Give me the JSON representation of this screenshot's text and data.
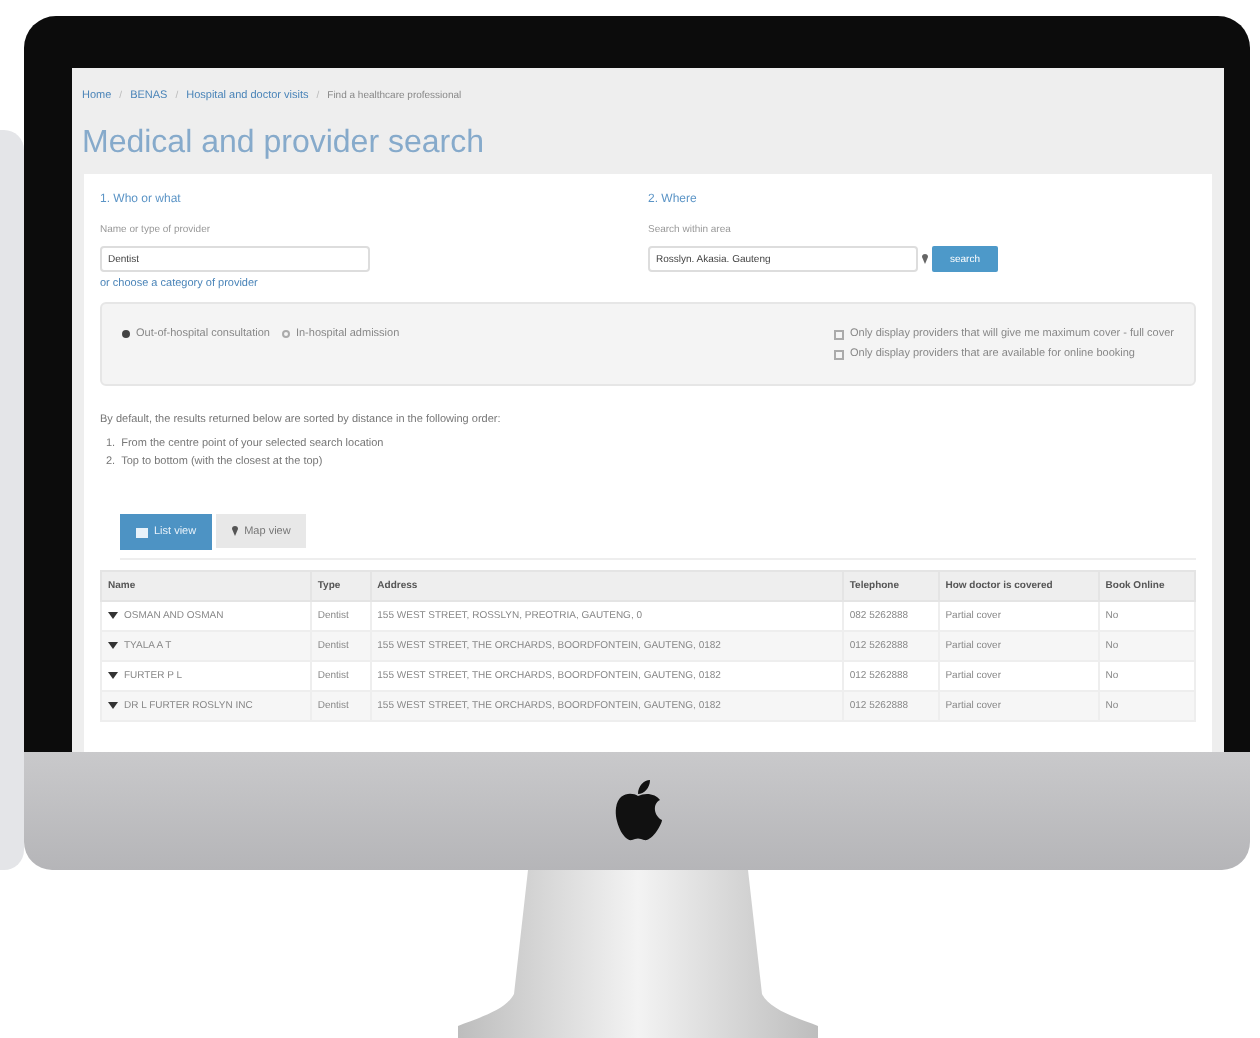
{
  "breadcrumb": {
    "separator": "/",
    "items": [
      {
        "label": "Home",
        "kind": "link"
      },
      {
        "label": "BENAS",
        "kind": "link"
      },
      {
        "label": "Hospital and doctor visits",
        "kind": "link"
      },
      {
        "label": "Find a healthcare professional",
        "kind": "current"
      }
    ]
  },
  "title": "Medical and provider search",
  "who": {
    "heading": "1. Who or what",
    "label": "Name or type of provider",
    "value": "Dentist",
    "link": "or choose a category of provider"
  },
  "where": {
    "heading": "2. Where",
    "label": "Search within area",
    "value": "Rosslyn. Akasia. Gauteng",
    "button": "search"
  },
  "radios": [
    {
      "label": "Out-of-hospital consultation",
      "selected": true
    },
    {
      "label": "In-hospital admission",
      "selected": false
    }
  ],
  "checkboxes": [
    {
      "label": "Only display providers that will give me maximum cover - full cover",
      "checked": false
    },
    {
      "label": "Only display providers that are available for online booking",
      "checked": false
    }
  ],
  "sort_note": "By default, the results returned below are sorted by distance in the following order:",
  "sort_order": [
    {
      "number": "1.",
      "text": "From the centre point of your selected search location"
    },
    {
      "number": "2.",
      "text": "Top to bottom (with the closest at the top)"
    }
  ],
  "view_tabs": [
    {
      "label": "List view",
      "kind": "list",
      "selected": true
    },
    {
      "label": "Map view",
      "kind": "map",
      "selected": false
    }
  ],
  "table": {
    "columns": [
      "Name",
      "Type",
      "Address",
      "Telephone",
      "How doctor is covered",
      "Book Online"
    ],
    "rows": [
      [
        "OSMAN AND OSMAN",
        "Dentist",
        "155 WEST STREET, ROSSLYN, PREOTRIA, GAUTENG, 0",
        "082 5262888",
        "Partial cover",
        "No"
      ],
      [
        "TYALA A T",
        "Dentist",
        "155 WEST STREET, THE ORCHARDS, BOORDFONTEIN, GAUTENG, 0182",
        "012 5262888",
        "Partial cover",
        "No"
      ],
      [
        "FURTER P L",
        "Dentist",
        "155 WEST STREET, THE ORCHARDS, BOORDFONTEIN, GAUTENG, 0182",
        "012 5262888",
        "Partial cover",
        "No"
      ],
      [
        "DR L FURTER ROSLYN INC",
        "Dentist",
        "155 WEST STREET, THE ORCHARDS, BOORDFONTEIN, GAUTENG, 0182",
        "012 5262888",
        "Partial cover",
        "No"
      ]
    ]
  }
}
